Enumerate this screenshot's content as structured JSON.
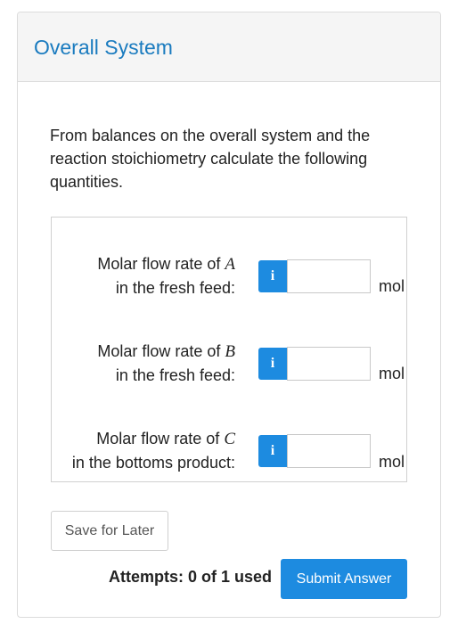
{
  "header": {
    "title": "Overall System"
  },
  "intro": "From balances on the overall system and the reaction stoichiometry calculate the following quantities.",
  "questions": [
    {
      "label_pre": "Molar flow rate of ",
      "var": "A",
      "label_line2": "in the fresh feed:",
      "info": "i",
      "value": "",
      "unit": "mol"
    },
    {
      "label_pre": "Molar flow rate of ",
      "var": "B",
      "label_line2": "in the fresh feed:",
      "info": "i",
      "value": "",
      "unit": "mol"
    },
    {
      "label_pre": "Molar flow rate of ",
      "var": "C",
      "label_line2": "in the bottoms product:",
      "info": "i",
      "value": "",
      "unit": "mol"
    }
  ],
  "footer": {
    "save_label": "Save for Later",
    "attempts": "Attempts: 0 of 1 used",
    "submit_label": "Submit Answer"
  }
}
